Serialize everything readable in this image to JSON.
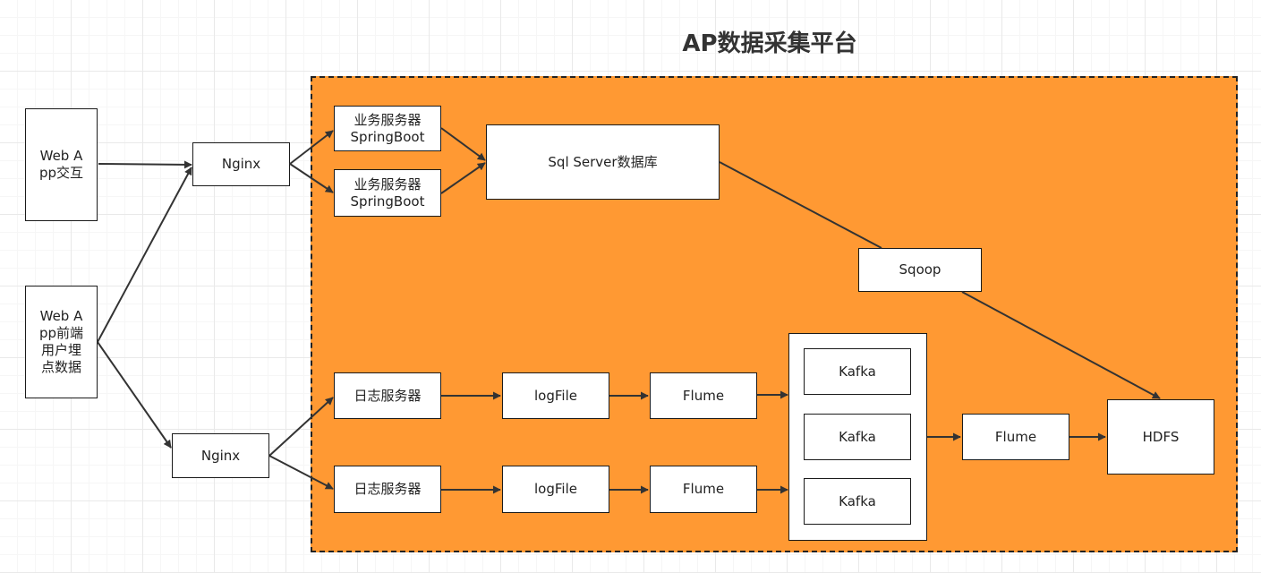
{
  "title": "AP数据采集平台",
  "nodes": {
    "web_app_interact": "Web App交互",
    "web_app_tracking": "Web App前端用户埋点数据",
    "nginx_top": "Nginx",
    "nginx_bottom": "Nginx",
    "business_server_1": "业务服务器 SpringBoot",
    "business_server_2": "业务服务器 SpringBoot",
    "sql_server_db": "Sql Server数据库",
    "sqoop": "Sqoop",
    "log_server_1": "日志服务器",
    "log_server_2": "日志服务器",
    "logfile_1": "logFile",
    "logfile_2": "logFile",
    "flume_1": "Flume",
    "flume_2": "Flume",
    "kafka_1": "Kafka",
    "kafka_2": "Kafka",
    "kafka_3": "Kafka",
    "flume_3": "Flume",
    "hdfs": "HDFS"
  },
  "colors": {
    "platform_fill": "#ff9933",
    "node_fill": "#ffffff",
    "stroke": "#333333"
  }
}
